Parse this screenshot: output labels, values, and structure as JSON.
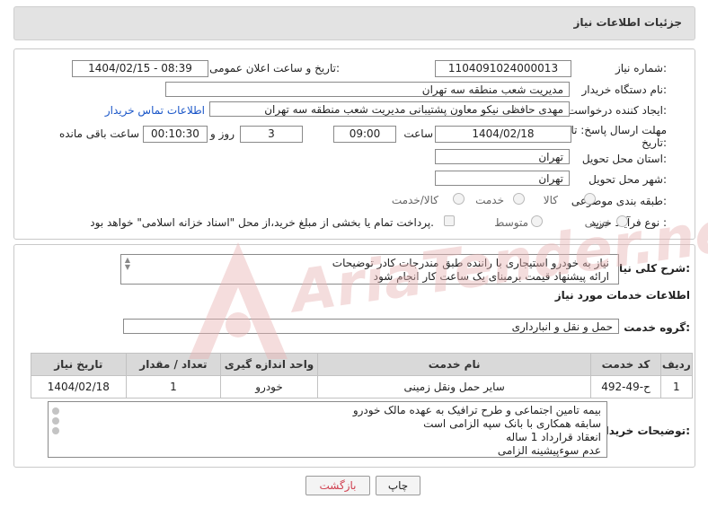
{
  "header": {
    "title": "جزئیات اطلاعات نیاز"
  },
  "fields": {
    "need_number_label": "شماره نیاز:",
    "need_number": "1104091024000013",
    "announce_label": "تاریخ و ساعت اعلان عمومی:",
    "announce_value": "1404/02/15 - 08:39",
    "buyer_org_label": "نام دستگاه خریدار:",
    "buyer_org": "مدیریت شعب منطقه سه تهران",
    "creator_label": "ایجاد کننده درخواست:",
    "creator": "مهدی حافظی نیکو معاون پشتیبانی مدیریت شعب منطقه سه تهران",
    "contact_link": "اطلاعات تماس خریدار",
    "deadline_label_1": "مهلت ارسال پاسخ: تا",
    "deadline_label_2": "تاریخ:",
    "deadline_date": "1404/02/18",
    "time_label": "ساعت",
    "deadline_time": "09:00",
    "days_value": "3",
    "days_label": "روز و",
    "remaining_time": "00:10:30",
    "remaining_label": "ساعت باقی مانده",
    "province_label": "استان محل تحویل:",
    "province": "تهران",
    "city_label": "شهر محل تحویل:",
    "city": "تهران",
    "category_label": "طبقه بندی موضوعی:",
    "category_options": [
      "کالا",
      "خدمت",
      "کالا/خدمت"
    ],
    "process_label": "نوع فرآیند خرید :",
    "process_options": [
      "جزیی",
      "متوسط"
    ],
    "payment_note": "پرداخت تمام یا بخشی از مبلغ خرید،از محل \"اسناد خزانه اسلامی\" خواهد بود."
  },
  "summary": {
    "label": "شرح کلی نیاز:",
    "lines": [
      "نیاز به خودرو استیجاری با راننده طبق مندرجات کادر توضیحات",
      "ارائه پیشنهاد قیمت برمبنای یک ساعت کار انجام شود"
    ]
  },
  "services": {
    "section_title": "اطلاعات خدمات مورد نیاز",
    "group_label": "گروه خدمت:",
    "group_value": "حمل و نقل و انبارداری",
    "columns": [
      "ردیف",
      "کد خدمت",
      "نام خدمت",
      "واحد اندازه گیری",
      "تعداد / مقدار",
      "تاریخ نیاز"
    ],
    "rows": [
      [
        "1",
        "ح-49-492",
        "سایر حمل ونقل زمینی",
        "خودرو",
        "1",
        "1404/02/18"
      ]
    ]
  },
  "buyer_notes": {
    "label": "توضیحات خریدار:",
    "lines": [
      "بیمه تامین اجتماعی و طرح ترافیک به عهده مالک خودرو",
      "سابقه همکاری با بانک سپه الزامی است",
      "انعقاد قرارداد 1 ساله",
      "عدم سوءپیشینه الزامی"
    ]
  },
  "buttons": {
    "print": "چاپ",
    "back": "بازگشت"
  },
  "watermark": {
    "text": "AriaTender.neT"
  },
  "colors": {
    "link": "#1a56c8",
    "header_bg": "#e3e3e3",
    "table_header": "#d9d9d9",
    "back_button_text": "#d04050",
    "watermark": "#e8b4b4"
  }
}
